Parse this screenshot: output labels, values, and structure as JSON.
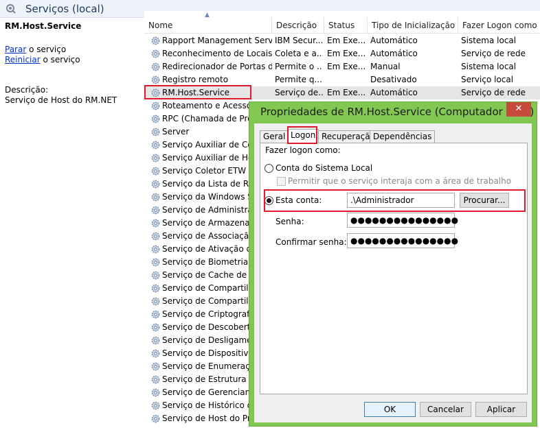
{
  "window": {
    "title": "Serviços (local)"
  },
  "left_pane": {
    "service_name": "RM.Host.Service",
    "stop_link": "Parar",
    "stop_text": " o serviço",
    "restart_link": "Reiniciar",
    "restart_text": " o serviço",
    "description_label": "Descrição:",
    "description_value": "Serviço de Host do RM.NET"
  },
  "table": {
    "columns": [
      "Nome",
      "Descrição",
      "Status",
      "Tipo de Inicialização",
      "Fazer Logon como"
    ],
    "rows": [
      {
        "name": "Rapport Management Service",
        "desc": "IBM Secur...",
        "status": "Em Exe...",
        "tipo": "Automático",
        "logon": "Sistema local"
      },
      {
        "name": "Reconhecimento de Locais ...",
        "desc": "Coleta e a...",
        "status": "Em Exe...",
        "tipo": "Automático",
        "logon": "Serviço de rede"
      },
      {
        "name": "Redirecionador de Portas d...",
        "desc": "Permite o ...",
        "status": "Em Exe...",
        "tipo": "Manual",
        "logon": "Sistema local"
      },
      {
        "name": "Registro remoto",
        "desc": "Permite q...",
        "status": "",
        "tipo": "Desativado",
        "logon": "Serviço local"
      },
      {
        "name": "RM.Host.Service",
        "desc": "Serviço de...",
        "status": "Em Exe...",
        "tipo": "Automático",
        "logon": "Serviço de rede"
      },
      {
        "name": "Roteamento e Acesso Remoto",
        "desc": "",
        "status": "",
        "tipo": "",
        "logon": ""
      },
      {
        "name": "RPC (Chamada de Procedimento Remoto)",
        "desc": "",
        "status": "",
        "tipo": "",
        "logon": ""
      },
      {
        "name": "Server",
        "desc": "",
        "status": "",
        "tipo": "",
        "logon": ""
      },
      {
        "name": "Serviço Auxiliar de Compatibilidade",
        "desc": "",
        "status": "",
        "tipo": "",
        "logon": ""
      },
      {
        "name": "Serviço Auxiliar de Host",
        "desc": "",
        "status": "",
        "tipo": "",
        "logon": ""
      },
      {
        "name": "Serviço Coletor ETW do Internet Explorer",
        "desc": "",
        "status": "",
        "tipo": "",
        "logon": ""
      },
      {
        "name": "Serviço da Lista de Redes",
        "desc": "",
        "status": "",
        "tipo": "",
        "logon": ""
      },
      {
        "name": "Serviço da Windows Store",
        "desc": "",
        "status": "",
        "tipo": "",
        "logon": ""
      },
      {
        "name": "Serviço de Administração",
        "desc": "",
        "status": "",
        "tipo": "",
        "logon": ""
      },
      {
        "name": "Serviço de Armazenamento",
        "desc": "",
        "status": "",
        "tipo": "",
        "logon": ""
      },
      {
        "name": "Serviço de Associação de Dispositivos",
        "desc": "",
        "status": "",
        "tipo": "",
        "logon": ""
      },
      {
        "name": "Serviço de Ativação de Processos",
        "desc": "",
        "status": "",
        "tipo": "",
        "logon": ""
      },
      {
        "name": "Serviço de Biometria do Windows",
        "desc": "",
        "status": "",
        "tipo": "",
        "logon": ""
      },
      {
        "name": "Serviço de Cache de Fontes",
        "desc": "",
        "status": "",
        "tipo": "",
        "logon": ""
      },
      {
        "name": "Serviço de Compartilhamento",
        "desc": "",
        "status": "",
        "tipo": "",
        "logon": ""
      },
      {
        "name": "Serviço de Compartilhamento de Rede",
        "desc": "",
        "status": "",
        "tipo": "",
        "logon": ""
      },
      {
        "name": "Serviço de Criptografia",
        "desc": "",
        "status": "",
        "tipo": "",
        "logon": ""
      },
      {
        "name": "Serviço de Descoberta Automática",
        "desc": "",
        "status": "",
        "tipo": "",
        "logon": ""
      },
      {
        "name": "Serviço de Desligamento",
        "desc": "",
        "status": "",
        "tipo": "",
        "logon": ""
      },
      {
        "name": "Serviço de Dispositivos",
        "desc": "",
        "status": "",
        "tipo": "",
        "logon": ""
      },
      {
        "name": "Serviço de Enumeração",
        "desc": "",
        "status": "",
        "tipo": "",
        "logon": ""
      },
      {
        "name": "Serviço de Estrutura de Áudio",
        "desc": "",
        "status": "",
        "tipo": "",
        "logon": ""
      },
      {
        "name": "Serviço de Gerenciamento",
        "desc": "",
        "status": "",
        "tipo": "",
        "logon": ""
      },
      {
        "name": "Serviço de Histórico de Arquivos",
        "desc": "",
        "status": "",
        "tipo": "",
        "logon": ""
      },
      {
        "name": "Serviço de Host do Provedor",
        "desc": "",
        "status": "",
        "tipo": "",
        "logon": ""
      }
    ]
  },
  "dialog": {
    "title": "Propriedades de RM.Host.Service (Computador local)",
    "close_glyph": "✕",
    "tabs": [
      "Geral",
      "Logon",
      "Recuperação",
      "Dependências"
    ],
    "active_tab": "Logon",
    "logon_as_label": "Fazer logon como:",
    "local_system_label": "Conta do Sistema Local",
    "interact_desktop_label": "Permitir que o serviço interaja com a área de trabalho",
    "this_account_label": "Esta conta:",
    "account_value": ".\\Administrador",
    "browse_button": "Procurar...",
    "password_label": "Senha:",
    "password_value": "●●●●●●●●●●●●●●●",
    "confirm_label": "Confirmar senha:",
    "confirm_value": "●●●●●●●●●●●●●●●",
    "ok_button": "OK",
    "cancel_button": "Cancelar",
    "apply_button": "Aplicar"
  },
  "icons": {
    "window": "gear-magnifier-icon",
    "row": "gear-icon"
  },
  "colors": {
    "highlight_box": "#e0192a",
    "dialog_frame": "#81c751",
    "close_button": "#c74b3c",
    "link": "#0033cc"
  }
}
